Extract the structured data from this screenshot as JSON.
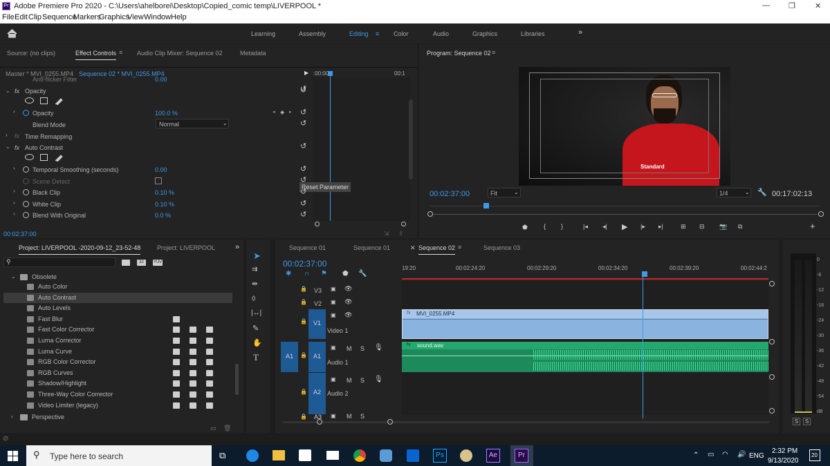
{
  "titlebar": {
    "app_icon": "Pr",
    "title": "Adobe Premiere Pro 2020 - C:\\Users\\ahelborei\\Desktop\\Copied_comic temp\\LIVERPOOL  *",
    "minimize": "—",
    "restore": "❐",
    "close": "✕"
  },
  "menu": [
    "File",
    "Edit",
    "Clip",
    "Sequence",
    "Markers",
    "Graphics",
    "View",
    "Window",
    "Help"
  ],
  "workspaces": [
    "Learning",
    "Assembly",
    "Editing",
    "Color",
    "Audio",
    "Graphics",
    "Libraries"
  ],
  "workspace_active": "Editing",
  "workspace_more": "»",
  "source_panel": {
    "tabs": [
      "Source: (no clips)",
      "Effect Controls",
      "Audio Clip Mixer: Sequence 02",
      "Metadata"
    ],
    "master": "Master * MVI_0255.MP4",
    "sequence": "Sequence 02 * MVI_0255.MP4",
    "timeline_start": ":00:00",
    "timeline_end": "00:1",
    "partial_row": "Anti-flicker Filter",
    "partial_value": "0.00",
    "opacity_group": "Opacity",
    "opacity_label": "Opacity",
    "opacity_value": "100.0 %",
    "blend_label": "Blend Mode",
    "blend_value": "Normal",
    "time_remap": "Time Remapping",
    "auto_contrast": "Auto Contrast",
    "temporal_label": "Temporal Smoothing (seconds)",
    "temporal_value": "0.00",
    "scene_label": "Scene Detect",
    "black_label": "Black Clip",
    "black_value": "0.10 %",
    "white_label": "White Clip",
    "white_value": "0.10 %",
    "blend_orig_label": "Blend With Original",
    "blend_orig_value": "0.0 %",
    "tooltip": "Reset Parameter",
    "timecode": "00:02:37:00",
    "fx_symbol": "fx"
  },
  "program": {
    "title": "Program: Sequence 02",
    "timecode": "00:02:37:00",
    "fit": "Fit",
    "quality": "1/4",
    "duration": "00:17:02:13",
    "jersey_text": "Standard"
  },
  "project": {
    "title": "Project: LIVERPOOL -2020-09-12_23-52-48",
    "title2": "Project: LIVERPOOL",
    "folder": "Obsolete",
    "items": [
      "Auto Color",
      "Auto Contrast",
      "Auto Levels",
      "Fast Blur",
      "Fast Color Corrector",
      "Luma Corrector",
      "Luma Curve",
      "RGB Color Corrector",
      "RGB Curves",
      "Shadow/Highlight",
      "Three-Way Color Corrector",
      "Video Limiter (legacy)"
    ],
    "folder2": "Perspective",
    "filter_badges": [
      "32",
      "YUV"
    ]
  },
  "timeline": {
    "tabs": [
      "Sequence 01",
      "Sequence 01",
      "Sequence 02",
      "Sequence 03"
    ],
    "timecode": "00:02:37:00",
    "ruler": [
      "19:20",
      "00:02:24:20",
      "00:02:29:20",
      "00:02:34:20",
      "00:02:39:20",
      "00:02:44:2"
    ],
    "tracks": {
      "v3": "V3",
      "v2": "V2",
      "v1": "V1",
      "video1": "Video 1",
      "a1_src": "A1",
      "a1": "A1",
      "audio1": "Audio 1",
      "a2": "A2",
      "audio2": "Audio 2",
      "a3": "A3",
      "mute": "M",
      "solo": "S"
    },
    "video_clip": "MVI_0255.MP4",
    "audio_clip": "sound.wav"
  },
  "meter": {
    "scale": [
      "0",
      "-6",
      "-12",
      "-18",
      "-24",
      "-30",
      "-36",
      "-42",
      "-48",
      "-54",
      "dB"
    ],
    "solo_left": "S",
    "solo_right": "S"
  },
  "taskbar": {
    "search_placeholder": "Type here to search",
    "language": "ENG",
    "time": "2:32 PM",
    "date": "9/13/2020",
    "notification_count": "20"
  }
}
